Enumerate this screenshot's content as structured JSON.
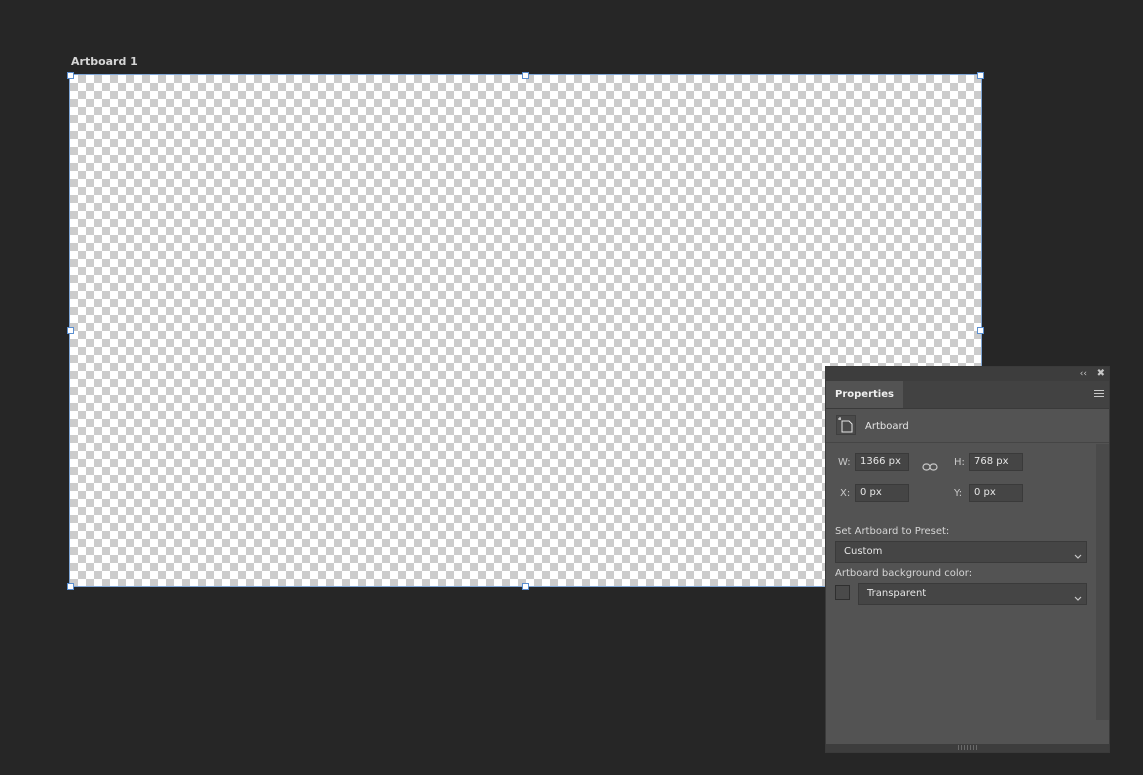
{
  "canvas": {
    "artboard_label": "Artboard 1"
  },
  "panel": {
    "tab_label": "Properties",
    "collapse_icon": "double-chevron-left-icon",
    "close_icon": "close-icon",
    "menu_icon": "hamburger-menu-icon",
    "artboard_icon": "artboard-icon",
    "type_label": "Artboard",
    "width_label": "W:",
    "width_value": "1366 px",
    "height_label": "H:",
    "height_value": "768 px",
    "x_label": "X:",
    "x_value": "0 px",
    "y_label": "Y:",
    "y_value": "0 px",
    "link_icon": "link-icon",
    "preset_label": "Set Artboard to Preset:",
    "preset_value": "Custom",
    "bg_color_label": "Artboard background color:",
    "bg_color_value": "Transparent"
  },
  "colors": {
    "workspace_bg": "#262626",
    "panel_bg": "#535353",
    "selection_outline": "#7fa6d6"
  }
}
